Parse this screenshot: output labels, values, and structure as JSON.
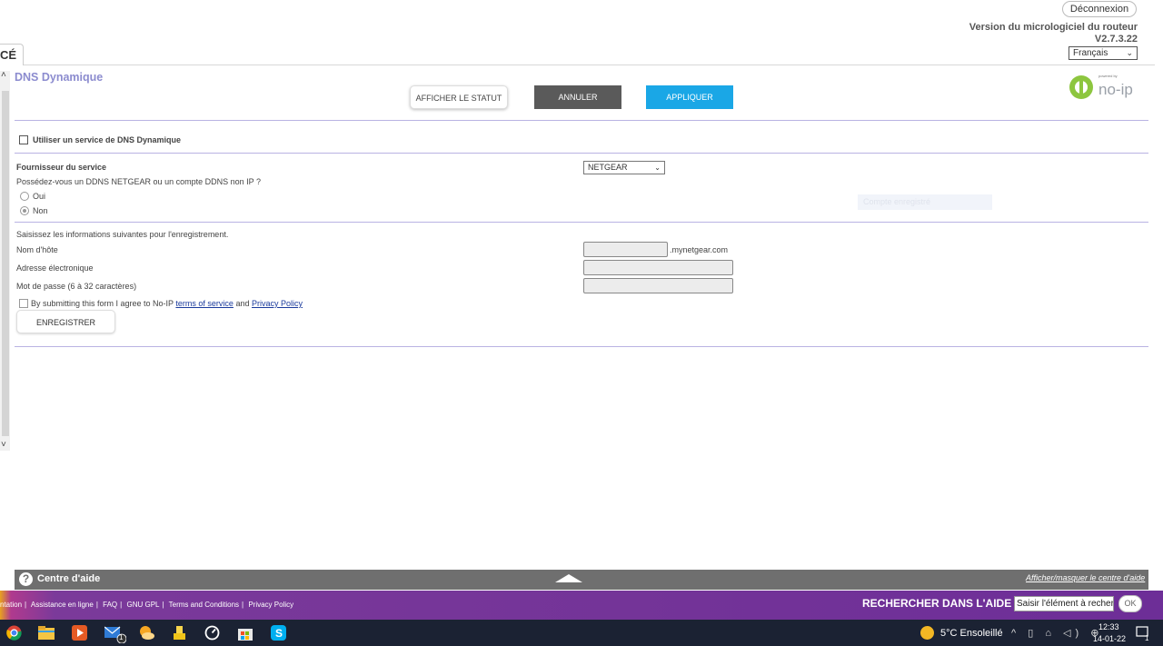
{
  "header": {
    "logout_label": "Déconnexion",
    "firmware_label": "Version du micrologiciel du routeur",
    "firmware_version": "V2.7.3.22",
    "language": "Français",
    "tab_stub": "CÉ"
  },
  "page": {
    "title": "DNS Dynamique",
    "buttons": {
      "status": "AFFICHER LE STATUT",
      "cancel": "ANNULER",
      "apply": "APPLIQUER"
    },
    "logo": {
      "powered_by": "powered by",
      "brand": "no-ip"
    }
  },
  "form": {
    "use_ddns_label": "Utiliser un service de DNS Dynamique",
    "use_ddns_checked": false,
    "provider_label": "Fournisseur du service",
    "provider_value": "NETGEAR",
    "has_account_question": "Possédez-vous un DDNS NETGEAR ou un compte DDNS non IP ?",
    "radio_yes": "Oui",
    "radio_no": "Non",
    "selected": "Non",
    "ghost_button": "Compte enregistré",
    "register_intro": "Saisissez les informations suivantes pour l'enregistrement.",
    "hostname_label": "Nom d'hôte",
    "hostname_value": "",
    "hostname_suffix": ".mynetgear.com",
    "email_label": "Adresse électronique",
    "email_value": "",
    "password_label": "Mot de passe (6 à 32 caractères)",
    "password_value": "",
    "agree_prefix": "By submitting this form I agree to No-IP",
    "terms_link": "terms of service",
    "agree_and": "and",
    "privacy_link": "Privacy Policy",
    "register_button": "ENREGISTRER"
  },
  "help": {
    "icon": "?",
    "title": "Centre d'aide",
    "toggle": "Afficher/masquer le centre d'aide"
  },
  "footer": {
    "links": [
      "ntation",
      "Assistance en ligne",
      "FAQ",
      "GNU GPL",
      "Terms and Conditions",
      "Privacy Policy"
    ],
    "search_label": "RECHERCHER DANS L'AIDE",
    "search_placeholder": "Saisir l'élément à rechercher",
    "search_ok": "OK"
  },
  "taskbar": {
    "weather": "5°C  Ensoleillé",
    "time": "12:33",
    "date": "14-01-22",
    "mail_badge": "1",
    "notify_badge": "1"
  },
  "colors": {
    "title": "#8c8ccf",
    "apply": "#1aa7e6",
    "cancel": "#5a5a5a",
    "rule": "#b9b3e3",
    "footer_purple": "#6d2e97"
  }
}
